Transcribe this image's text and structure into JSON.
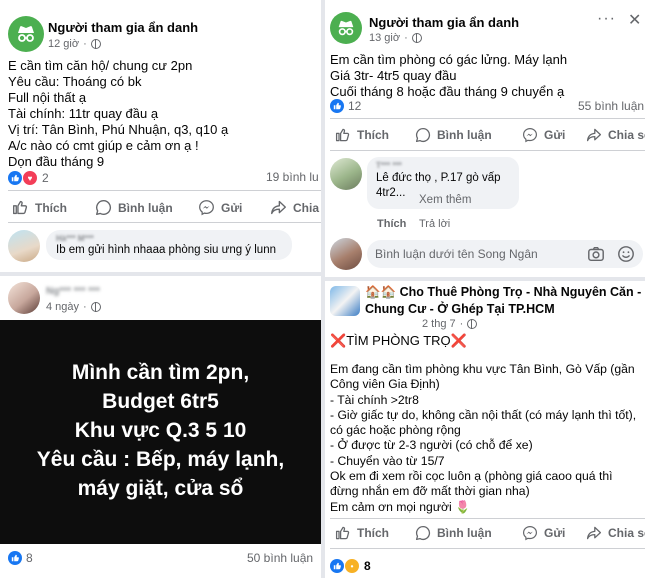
{
  "colors": {
    "accent": "#1877f2",
    "anon_avatar": "#4caf50",
    "dark_post_bg": "#0d0d0d",
    "divider": "#e4e6eb"
  },
  "actions": {
    "like": "Thích",
    "comment": "Bình luận",
    "send": "Gửi",
    "share": "Chia sẻ"
  },
  "left": {
    "post1": {
      "author": "Người tham gia ẩn danh",
      "time": "12 giờ",
      "avatar_icon": "anonymous-spy-icon",
      "body": "E cần tìm căn hộ/ chung cư 2pn\nYêu cầu: Thoáng có bk\nFull nội thất ạ\nTài chính: 11tr quay đầu ạ\nVị trí: Tân Bình, Phú Nhuận, q3, q10 ạ\nA/c nào có cmt giúp e cảm ơn ạ !\nDọn đầu tháng 9",
      "reaction_count": "2",
      "comment_count": "19 bình lu",
      "comment": {
        "name": "Hà*** M***",
        "text": "Ib em gửi hình nhaaa phòng siu ưng ý lunn"
      }
    },
    "post2": {
      "author": "Ng*** *** ***",
      "time": "4 ngày",
      "image_text": "Mình cần tìm 2pn,\nBudget 6tr5\nKhu vực Q.3 5 10\nYêu cầu : Bếp, máy lạnh,\nmáy giặt, cửa sổ",
      "reaction_count": "8",
      "comment_count": "50 bình luận"
    }
  },
  "right": {
    "post1": {
      "author": "Người tham gia ẩn danh",
      "time": "13 giờ",
      "body": "Em cần tìm phòng có gác lửng. Máy lạnh\nGiá 3tr- 4tr5 quay đầu\nCuối tháng 8 hoặc đầu tháng 9 chuyển ạ",
      "reaction_count": "12",
      "comment_count": "55 bình luận",
      "comment": {
        "name": "T*** ***",
        "text": "Lê đức thọ , P.17 gò vấp\n4tr2...",
        "see_more": "Xem thêm",
        "like": "Thích",
        "reply": "Trả lời"
      },
      "input_placeholder": "Bình luận dưới tên Song Ngân"
    },
    "post2": {
      "author": "🏠🏠 Cho Thuê Phòng Trọ - Nhà Nguyên Căn - Chung Cư - Ở Ghép Tại TP.HCM",
      "time": "2 thg 7",
      "heading_mark": "❌",
      "heading_text": "TÌM PHÒNG TRỌ",
      "body": "Em đang cần tìm phòng khu vực Tân Bình, Gò Vấp (gần Công viên Gia Định)\n- Tài chính >2tr8\n- Giờ giấc tự do, không cần nội thất (có máy lạnh thì tốt), có gác hoặc phòng rộng\n- Ở được từ 2-3 người (có chỗ để xe)\n- Chuyển vào từ 15/7\nOk em đi xem rồi cọc luôn ạ (phòng giá caoo quá thì đừng nhắn em đỡ mất thời gian nha)\nEm cảm ơn mọi người 🌷",
      "reaction_count": "8"
    }
  }
}
